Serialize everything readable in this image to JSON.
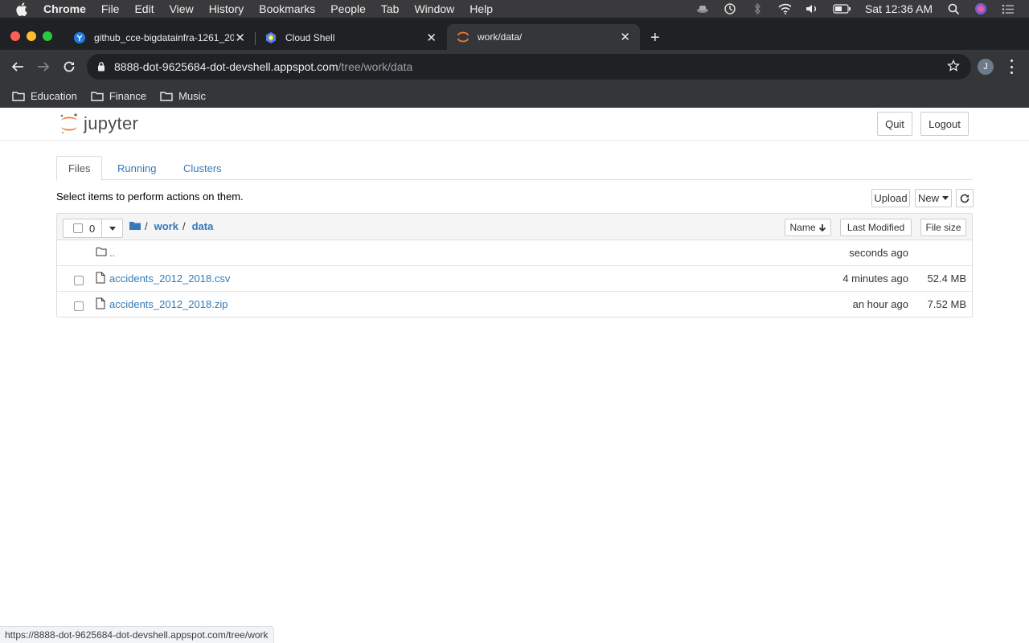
{
  "menubar": {
    "items": [
      "Chrome",
      "File",
      "Edit",
      "View",
      "History",
      "Bookmarks",
      "People",
      "Tab",
      "Window",
      "Help"
    ],
    "clock": "Sat 12:36 AM"
  },
  "tabs": [
    {
      "title": "github_cce-bigdatainfra-1261_20",
      "icon": "git-icon"
    },
    {
      "title": "Cloud Shell",
      "icon": "cloud-shell-icon"
    },
    {
      "title": "work/data/",
      "icon": "jupyter-icon"
    }
  ],
  "omnibox": {
    "host": "8888-dot-9625684-dot-devshell.appspot.com",
    "path": "/tree/work/data"
  },
  "profile_initial": "J",
  "bookmarks": [
    "Education",
    "Finance",
    "Music"
  ],
  "jupyter": {
    "logo_text": "jupyter",
    "quit_label": "Quit",
    "logout_label": "Logout",
    "tabs": [
      "Files",
      "Running",
      "Clusters"
    ],
    "hint": "Select items to perform actions on them.",
    "upload_label": "Upload",
    "new_label": "New",
    "selected_count": "0",
    "breadcrumb": [
      "work",
      "data"
    ],
    "sort_name": "Name",
    "sort_modified": "Last Modified",
    "sort_size": "File size",
    "files": [
      {
        "name": "..",
        "modified": "seconds ago",
        "size": "",
        "type": "folder"
      },
      {
        "name": "accidents_2012_2018.csv",
        "modified": "4 minutes ago",
        "size": "52.4 MB",
        "type": "file"
      },
      {
        "name": "accidents_2012_2018.zip",
        "modified": "an hour ago",
        "size": "7.52 MB",
        "type": "file"
      }
    ]
  },
  "status_url": "https://8888-dot-9625684-dot-devshell.appspot.com/tree/work",
  "colors": {
    "link": "#337ab7",
    "jupyter_orange": "#f37726"
  }
}
